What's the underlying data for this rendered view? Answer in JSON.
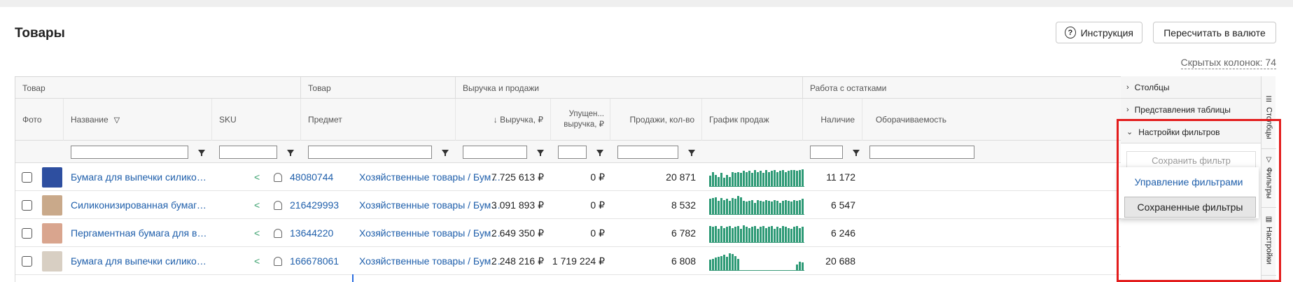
{
  "page": {
    "title": "Товары",
    "help_button": "Инструкция",
    "convert_button": "Пересчитать в валюте",
    "hidden_columns": "Скрытых колонок: 74"
  },
  "groups": [
    "Товар",
    "Товар",
    "Выручка и продажи",
    "Работа с остатками"
  ],
  "columns": {
    "photo": "Фото",
    "name": "Название",
    "sku": "SKU",
    "subject": "Предмет",
    "revenue": "↓ Выручка, ₽",
    "lost_revenue": "Упущен... выручка, ₽",
    "sales_qty": "Продажи, кол-во",
    "sales_chart": "График продаж",
    "stock": "Наличие",
    "turnover": "Оборачиваемость"
  },
  "rows": [
    {
      "name": "Бумага для выпечки силиконизи...",
      "sku": "48080744",
      "subject": "Хозяйственные товары / Бумага дл...",
      "revenue": "7 725 613 ₽",
      "lost": "0 ₽",
      "qty": "20 871",
      "stock": "11 172",
      "thumb": "#2e4fa0",
      "spark": [
        0.55,
        0.75,
        0.6,
        0.5,
        0.7,
        0.45,
        0.6,
        0.5,
        0.75,
        0.7,
        0.75,
        0.7,
        0.8,
        0.75,
        0.8,
        0.7,
        0.85,
        0.75,
        0.8,
        0.7,
        0.85,
        0.75,
        0.8,
        0.85,
        0.75,
        0.8,
        0.85,
        0.75,
        0.8,
        0.85,
        0.85,
        0.8,
        0.85,
        0.9
      ]
    },
    {
      "name": "Силиконизированная бумага для...",
      "sku": "216429993",
      "subject": "Хозяйственные товары / Бумага дл...",
      "revenue": "3 091 893 ₽",
      "lost": "0 ₽",
      "qty": "8 532",
      "stock": "6 547",
      "thumb": "#c9a98a",
      "spark": [
        0.8,
        0.85,
        0.9,
        0.7,
        0.85,
        0.75,
        0.8,
        0.7,
        0.85,
        0.8,
        0.95,
        0.9,
        0.7,
        0.65,
        0.7,
        0.75,
        0.6,
        0.75,
        0.7,
        0.65,
        0.75,
        0.7,
        0.65,
        0.75,
        0.7,
        0.6,
        0.7,
        0.75,
        0.7,
        0.65,
        0.75,
        0.7,
        0.75,
        0.8
      ]
    },
    {
      "name": "Пергаментная бумага для выпеч...",
      "sku": "13644220",
      "subject": "Хозяйственные товары / Бумага дл...",
      "revenue": "2 649 350 ₽",
      "lost": "0 ₽",
      "qty": "6 782",
      "stock": "6 246",
      "thumb": "#d9a58e",
      "spark": [
        0.85,
        0.8,
        0.85,
        0.7,
        0.85,
        0.75,
        0.8,
        0.85,
        0.75,
        0.8,
        0.85,
        0.7,
        0.9,
        0.8,
        0.75,
        0.8,
        0.85,
        0.7,
        0.8,
        0.85,
        0.75,
        0.8,
        0.85,
        0.7,
        0.8,
        0.75,
        0.85,
        0.8,
        0.75,
        0.7,
        0.8,
        0.85,
        0.75,
        0.8
      ]
    },
    {
      "name": "Бумага для выпечки силиконизи...",
      "sku": "166678061",
      "subject": "Хозяйственные товары / Бумага дл...",
      "revenue": "2 248 216 ₽",
      "lost": "1 719 224 ₽",
      "qty": "6 808",
      "stock": "20 688",
      "thumb": "#d8cfc3",
      "spark": [
        0.55,
        0.6,
        0.65,
        0.7,
        0.75,
        0.8,
        0.7,
        0.9,
        0.85,
        0.75,
        0.6,
        0,
        0,
        0,
        0,
        0,
        0,
        0,
        0,
        0,
        0,
        0,
        0,
        0,
        0,
        0,
        0,
        0,
        0,
        0,
        0,
        0.3,
        0.45,
        0.4
      ]
    }
  ],
  "sidebar": {
    "columns": "Столбцы",
    "views": "Представления таблицы",
    "filter_settings": "Настройки фильтров",
    "save_filter": "Сохранить фильтр",
    "manage_filters": "Управление фильтрами",
    "saved_filters": "Сохраненные фильтры"
  },
  "vtabs": [
    "Столбцы",
    "Фильтры",
    "Настройки"
  ],
  "colors": {
    "link": "#1f5fab",
    "chart": "#2e9a76",
    "highlight": "#e31c1c"
  }
}
